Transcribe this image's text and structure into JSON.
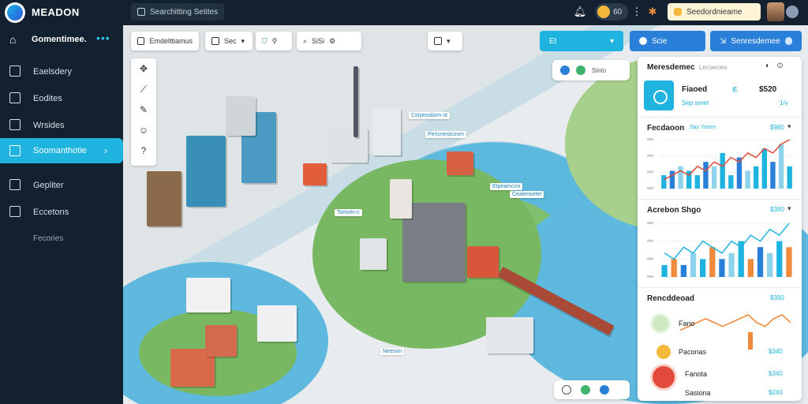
{
  "app": {
    "brand": "MEADON"
  },
  "topbar": {
    "search_label": "Searchitting Setites",
    "coin_value": "60",
    "user_label": "Seedordnieame"
  },
  "sidebar": {
    "header": "Gomentimee.",
    "items": [
      {
        "label": "Eaelsdery"
      },
      {
        "label": "Eodites"
      },
      {
        "label": "Wrsides"
      },
      {
        "label": "Soomanthotie"
      },
      {
        "label": "Gepliter"
      },
      {
        "label": "Eccetons"
      },
      {
        "label": "Fecories"
      }
    ]
  },
  "map": {
    "toolbar": {
      "t1": "Emdelttiamus",
      "t2": "Sec",
      "t3": "SiSi"
    },
    "btn_cyan": "Et",
    "btn_search": "Scie",
    "btn_share": "Senresdemee",
    "float_pill": "Sinto",
    "tags": [
      "Cstyesstiom-st",
      "Pencnestcosm",
      "Etpeamcnn",
      "Ceaiensetet",
      "Tomotn-c",
      "Neesnn"
    ]
  },
  "panel": {
    "title": "Meresdemec",
    "subtitle": "Lecsecies",
    "stat": {
      "label1": "Fiaoed",
      "label2": "Sep sreet",
      "value1": "$520",
      "value2": "1/v"
    },
    "sections": [
      {
        "title": "Fecdaoon",
        "tag": "Sas Yosen",
        "value": "$980"
      },
      {
        "title": "Acrebon Shgo",
        "tag": "",
        "value": "$380"
      },
      {
        "title": "Rencddeoad",
        "tag": "",
        "value": "$390"
      }
    ],
    "legend": [
      {
        "label": "Fano",
        "value": ""
      },
      {
        "label": "Paconas",
        "value": "$340"
      },
      {
        "label": "Fanota",
        "value": "$340"
      },
      {
        "label": "Sasiona",
        "value": "$240"
      }
    ]
  },
  "chart_data": [
    {
      "type": "bar",
      "title": "Fecdaoon",
      "values": [
        3,
        4,
        5,
        4,
        3,
        6,
        5,
        8,
        3,
        7,
        4,
        5,
        9,
        6,
        10,
        5
      ],
      "line": [
        2,
        3,
        4,
        3,
        5,
        4,
        6,
        5,
        7,
        6,
        8,
        7,
        9,
        8,
        10,
        11
      ]
    },
    {
      "type": "bar",
      "title": "Acrebon Shgo",
      "values": [
        2,
        3,
        2,
        4,
        3,
        5,
        3,
        4,
        6,
        3,
        5,
        4,
        6,
        5
      ],
      "line": [
        4,
        3,
        5,
        4,
        6,
        5,
        4,
        6,
        5,
        7,
        6,
        8,
        7,
        9
      ]
    },
    {
      "type": "line",
      "title": "Rencddeoad",
      "values": [
        5,
        6,
        7,
        8,
        7,
        6,
        7,
        8,
        9,
        7,
        6,
        8,
        9,
        7
      ]
    }
  ],
  "colors": {
    "accent": "#1fb4df",
    "sidebar": "#13202f",
    "orange": "#f08a3c",
    "red": "#e24a3b"
  }
}
